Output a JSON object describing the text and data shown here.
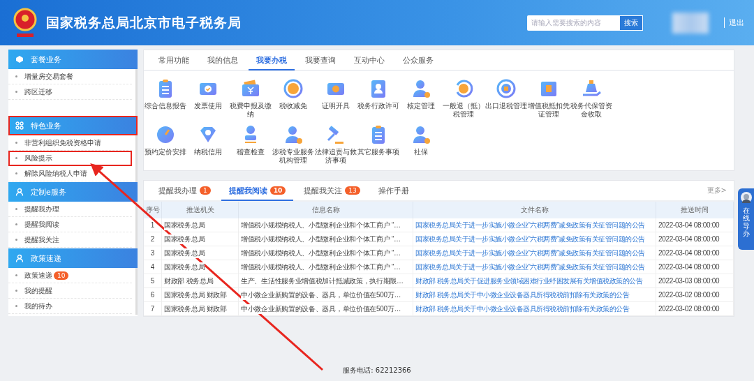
{
  "header": {
    "title": "国家税务总局北京市电子税务局",
    "search": {
      "placeholder": "请输入需要搜索的内容",
      "button": "搜索"
    },
    "logout": "退出"
  },
  "sidebar": [
    {
      "title": "套餐业务",
      "items": [
        {
          "label": "增量房交易套餐",
          "highlighted": false
        },
        {
          "label": "跨区迁移",
          "highlighted": false
        }
      ]
    },
    {
      "title": "特色业务",
      "highlighted": true,
      "items": [
        {
          "label": "非营利组织免税资格申请",
          "highlighted": false
        },
        {
          "label": "风险提示",
          "highlighted": true
        },
        {
          "label": "解除风险纳税人申请",
          "highlighted": false
        }
      ]
    },
    {
      "title": "定制e服务",
      "highlighted": false,
      "items": [
        {
          "label": "提醒我办理",
          "highlighted": false
        },
        {
          "label": "提醒我阅读",
          "highlighted": false
        },
        {
          "label": "提醒我关注",
          "highlighted": false
        }
      ]
    },
    {
      "title": "政策速递",
      "highlighted": false,
      "items": [
        {
          "label": "政策速递",
          "badge": "10",
          "highlighted": false
        },
        {
          "label": "我的提醒",
          "highlighted": false
        },
        {
          "label": "我的待办",
          "highlighted": false
        }
      ]
    }
  ],
  "service_tabs": [
    {
      "label": "常用功能",
      "selected": false
    },
    {
      "label": "我的信息",
      "selected": false
    },
    {
      "label": "我要办税",
      "selected": true
    },
    {
      "label": "我要查询",
      "selected": false
    },
    {
      "label": "互动中心",
      "selected": false
    },
    {
      "label": "公众服务",
      "selected": false
    }
  ],
  "services": [
    {
      "label": "综合信息报告"
    },
    {
      "label": "发票使用"
    },
    {
      "label": "税费申报及缴纳"
    },
    {
      "label": "税收减免"
    },
    {
      "label": "证明开具"
    },
    {
      "label": "税务行政许可"
    },
    {
      "label": "核定管理"
    },
    {
      "label": "一般退（抵）税管理"
    },
    {
      "label": "出口退税管理"
    },
    {
      "label": "增值税抵扣凭证管理"
    },
    {
      "label": "税务代保管资金收取"
    },
    {
      "label": "预约定价安排"
    },
    {
      "label": "纳税信用"
    },
    {
      "label": "稽查检查"
    },
    {
      "label": "涉税专业服务机构管理"
    },
    {
      "label": "法律追责与救济事项"
    },
    {
      "label": "其它服务事项"
    },
    {
      "label": "社保"
    }
  ],
  "reminder_tabs": [
    {
      "label": "提醒我办理",
      "badge": "1",
      "selected": false
    },
    {
      "label": "提醒我阅读",
      "badge": "10",
      "selected": true
    },
    {
      "label": "提醒我关注",
      "badge": "13",
      "selected": false
    },
    {
      "label": "操作手册",
      "selected": false
    }
  ],
  "more": "更多>",
  "table": {
    "columns": [
      "序号",
      "推送机关",
      "信息名称",
      "文件名称",
      "推送时间"
    ],
    "rows": [
      [
        "1",
        "国家税务总局",
        "增值税小规模纳税人、小型微利企业和个体工商户 “…",
        "国家税务总局关于进一步实施小微企业“六税两费”减免政策有关征管问题的公告",
        "2022-03-04 08:00:00"
      ],
      [
        "2",
        "国家税务总局",
        "增值税小规模纳税人、小型微利企业和个体工商户 “…",
        "国家税务总局关于进一步实施小微企业“六税两费”减免政策有关征管问题的公告",
        "2022-03-04 08:00:00"
      ],
      [
        "3",
        "国家税务总局",
        "增值税小规模纳税人、小型微利企业和个体工商户 “…",
        "国家税务总局关于进一步实施小微企业“六税两费”减免政策有关征管问题的公告",
        "2022-03-04 08:00:00"
      ],
      [
        "4",
        "国家税务总局",
        "增值税小规模纳税人、小型微利企业和个体工商户 “…",
        "国家税务总局关于进一步实施小微企业“六税两费”减免政策有关征管问题的公告",
        "2022-03-04 08:00:00"
      ],
      [
        "5",
        "财政部 税务总局",
        "生产、生活性服务业增值税加计抵减政策，执行期限…",
        "财政部 税务总局关于促进服务业领域困难行业纾困发展有关增值税政策的公告",
        "2022-03-03 08:00:00"
      ],
      [
        "6",
        "国家税务总局 财政部",
        "中小微企业新购置的设备、器具，单位价值在500万…",
        "财政部 税务总局关于中小微企业设备器具所得税税前扣除有关政策的公告",
        "2022-03-02 08:00:00"
      ],
      [
        "7",
        "国家税务总局 财政部",
        "中小微企业新购置的设备、器具，单位价值在500万…",
        "财政部 税务总局关于中小微企业设备器具所得税税前扣除有关政策的公告",
        "2022-03-02 08:00:00"
      ]
    ]
  },
  "footer": "服务电话: 62212366",
  "guide_widget": {
    "label": "在线导办"
  }
}
